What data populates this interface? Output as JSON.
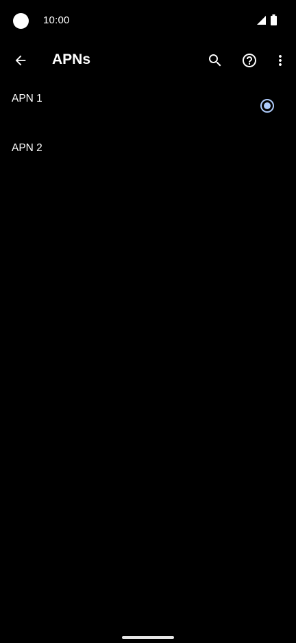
{
  "status_bar": {
    "time": "10:00",
    "icons": [
      "camera-cutout",
      "signal-icon",
      "battery-icon"
    ]
  },
  "app_bar": {
    "title": "APNs",
    "back_icon": "arrow-back-icon",
    "search_icon": "search-icon",
    "help_icon": "help-icon",
    "more_icon": "more-vert-icon"
  },
  "apns": [
    {
      "name": "APN 1",
      "selected": true
    },
    {
      "name": "APN 2",
      "selected": false
    }
  ],
  "colors": {
    "background": "#000000",
    "text": "#ffffff",
    "accent": "#aecbfa"
  }
}
